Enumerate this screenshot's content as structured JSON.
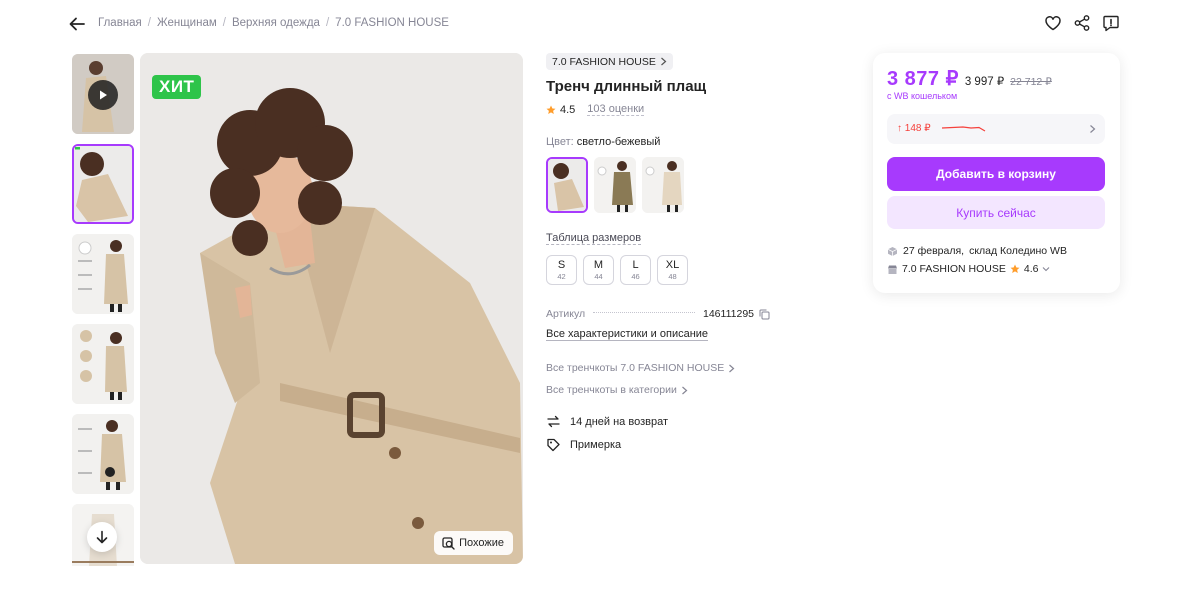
{
  "breadcrumbs": [
    "Главная",
    "Женщинам",
    "Верхняя одежда",
    "7.0 FASHION HOUSE"
  ],
  "product": {
    "brand": "7.0 FASHION HOUSE",
    "title": "Тренч длинный плащ",
    "rating": "4.5",
    "reviews": "103 оценки",
    "color_label": "Цвет:",
    "color_value": "светло-бежевый",
    "size_table_label": "Таблица размеров",
    "sizes": [
      {
        "size": "S",
        "num": "42"
      },
      {
        "size": "M",
        "num": "44"
      },
      {
        "size": "L",
        "num": "46"
      },
      {
        "size": "XL",
        "num": "48"
      }
    ],
    "article_label": "Артикул",
    "article_value": "146111295",
    "all_specs": "Все характеристики и описание",
    "links": [
      "Все тренчкоты 7.0 FASHION HOUSE",
      "Все тренчкоты в категории"
    ],
    "features": [
      "14 дней на возврат",
      "Примерка"
    ]
  },
  "gallery": {
    "badge": "ХИТ",
    "similar_label": "Похожие"
  },
  "price_card": {
    "wallet_price": "3 877 ₽",
    "regular_price": "3 997 ₽",
    "old_price": "22 712 ₽",
    "wallet_note": "с WB кошельком",
    "history_change": "↑ 148 ₽",
    "add_to_cart": "Добавить в корзину",
    "buy_now": "Купить сейчас",
    "delivery_date": "27 февраля,",
    "delivery_warehouse": "склад Коледино WB",
    "seller_name": "7.0 FASHION HOUSE",
    "seller_rating": "4.6"
  },
  "colors": {
    "accent": "#a73afd",
    "badge_green": "#2ec44a",
    "price_up_red": "#f5413c"
  }
}
